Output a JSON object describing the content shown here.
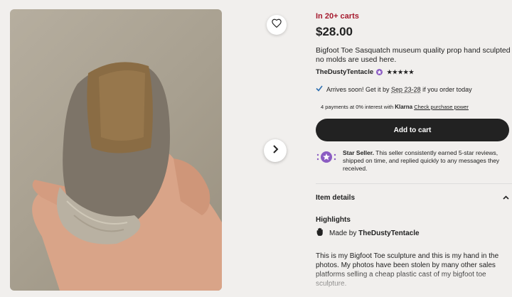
{
  "listing": {
    "in_carts": "In 20+ carts",
    "price": "$28.00",
    "title": "Bigfoot Toe Sasquatch museum quality prop hand sculpted no molds are used here.",
    "shop_name": "TheDustyTentacle",
    "rating_stars": "★★★★★",
    "rating_value": 5
  },
  "shipping": {
    "prefix": "Arrives soon! Get it by ",
    "date_range": "Sep 23-28",
    "suffix": " if you order today"
  },
  "klarna": {
    "prefix": "4 payments at 0% interest with ",
    "brand": "Klarna",
    "link": "Check purchase power"
  },
  "cart": {
    "button_label": "Add to cart"
  },
  "star_seller": {
    "label": "Star Seller.",
    "text": " This seller consistently earned 5-star reviews, shipped on time, and replied quickly to any messages they received."
  },
  "details": {
    "section_label": "Item details",
    "highlights_label": "Highlights",
    "made_by_prefix": "Made by ",
    "made_by_shop": "TheDustyTentacle",
    "description": "This is my Bigfoot Toe sculpture and this is my hand in the photos. My photos have been stolen by many other sales platforms selling a cheap plastic cast of my bigfoot toe sculpture."
  },
  "icons": {
    "favorite": "heart-icon",
    "next": "chevron-right-icon",
    "check": "check-icon",
    "star_seller": "star-seller-icon",
    "collapse": "chevron-up-icon",
    "made_by": "hand-icon"
  },
  "colors": {
    "background": "#f1efed",
    "accent_red": "#a61a2e",
    "button_dark": "#222222",
    "star_seller_purple": "#8b5cc2",
    "check_blue": "#2f6fb0"
  }
}
